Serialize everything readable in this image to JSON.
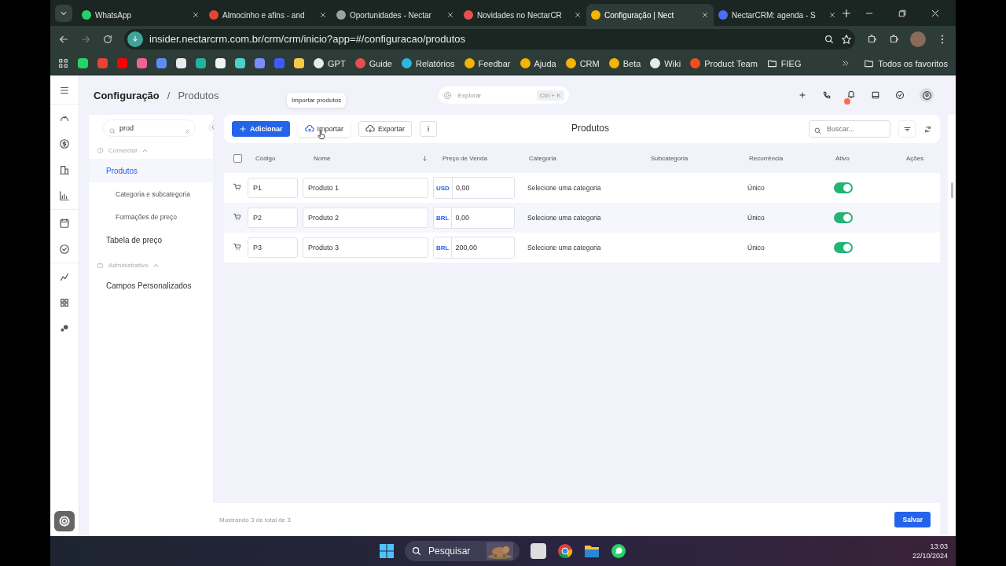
{
  "browser": {
    "tabs": [
      {
        "title": "WhatsApp",
        "color": "#25d366",
        "selected": false
      },
      {
        "title": "Almocinho e afins - and",
        "color": "#ea4335",
        "selected": false
      },
      {
        "title": "Oportunidades - Nectar",
        "color": "#9aa0a6",
        "selected": false
      },
      {
        "title": "Novidades no NectarCR",
        "color": "#e84f4f",
        "selected": false
      },
      {
        "title": "Configuração | Nect",
        "color": "#f5b400",
        "selected": true
      },
      {
        "title": "NectarCRM: agenda - S",
        "color": "#4a6cf7",
        "selected": false
      }
    ],
    "url": "insider.nectarcrm.com.br/crm/crm/inicio?app=#/configuracao/produtos",
    "bookmarks": [
      {
        "kind": "icon",
        "color": "#25d366"
      },
      {
        "kind": "icon",
        "color": "#ea4335"
      },
      {
        "kind": "icon",
        "color": "#ff0000"
      },
      {
        "kind": "icon",
        "color": "#f06292"
      },
      {
        "kind": "icon",
        "color": "#5c8df6"
      },
      {
        "kind": "icon",
        "color": "#e8eaed"
      },
      {
        "kind": "icon",
        "color": "#1fb59a"
      },
      {
        "kind": "icon",
        "color": "#f1f3f4"
      },
      {
        "kind": "icon",
        "color": "#4dd0c8"
      },
      {
        "kind": "icon",
        "color": "#7b8cff"
      },
      {
        "kind": "icon",
        "color": "#3f5bff"
      },
      {
        "kind": "icon",
        "color": "#f7c948"
      },
      {
        "kind": "link",
        "label": "GPT",
        "color": "#e8eaed"
      },
      {
        "kind": "link",
        "label": "Guide",
        "color": "#e84f4f"
      },
      {
        "kind": "link",
        "label": "Relatórios",
        "color": "#2ab7e0"
      },
      {
        "kind": "link",
        "label": "Feedbar",
        "color": "#f5b400"
      },
      {
        "kind": "link",
        "label": "Ajuda",
        "color": "#f5b400"
      },
      {
        "kind": "link",
        "label": "CRM",
        "color": "#f5b400"
      },
      {
        "kind": "link",
        "label": "Beta",
        "color": "#f5b400"
      },
      {
        "kind": "link",
        "label": "Wiki",
        "color": "#e8eaed"
      },
      {
        "kind": "link",
        "label": "Product Team",
        "color": "#f24e1e"
      },
      {
        "kind": "folder",
        "label": "FIEG"
      }
    ],
    "all_bookmarks": "Todos os favoritos"
  },
  "app": {
    "breadcrumb": [
      "Configuração",
      "Produtos"
    ],
    "breadcrumb_separator": "/",
    "explore": {
      "placeholder": "Explorar",
      "shortcut": "Ctrl + K"
    },
    "sidebar": {
      "search": "prod",
      "groups": [
        {
          "label": "Comercial",
          "expanded": true,
          "children": [
            {
              "label": "Produtos",
              "selected": true,
              "children": [
                {
                  "label": "Categoria e subcategoria",
                  "selected": false
                },
                {
                  "label": "Formações de preço",
                  "selected": false
                }
              ]
            },
            {
              "label": "Tabela de preço",
              "selected": false
            }
          ]
        },
        {
          "label": "Administrativo",
          "expanded": true,
          "children": [
            {
              "label": "Campos Personalizados",
              "selected": false
            }
          ]
        }
      ]
    },
    "toolbar": {
      "buttons": [
        {
          "kind": "primary",
          "label": "Adicionar"
        },
        {
          "kind": "import",
          "label": "Importar"
        },
        {
          "kind": "export",
          "label": "Exportar"
        }
      ],
      "tooltip": "Importar produtos",
      "title": "Produtos",
      "search_placeholder": "Buscar..."
    },
    "table": {
      "select_all": {
        "checked": false
      },
      "columns": [
        "Código",
        "Nome",
        "Preço de Venda",
        "Categoria",
        "Subcategoria",
        "Recorrência",
        "Ativo",
        "Ações"
      ],
      "rows": [
        {
          "code": "P1",
          "name": "Produto 1",
          "currency": "USD",
          "price": "0,00",
          "category": "Selecione uma categoria",
          "recurrence": "Único",
          "active": true
        },
        {
          "code": "P2",
          "name": "Produto 2",
          "currency": "BRL",
          "price": "0,00",
          "category": "Selecione uma categoria",
          "recurrence": "Único",
          "active": true
        },
        {
          "code": "P3",
          "name": "Produto 3",
          "currency": "BRL",
          "price": "200,00",
          "category": "Selecione uma categoria",
          "recurrence": "Único",
          "active": true
        }
      ]
    },
    "footer": {
      "summary": "Mostrando 3 de total de 3",
      "save": "Salvar"
    }
  },
  "taskbar": {
    "search": "Pesquisar",
    "time": "13:03",
    "date": "22/10/2024"
  }
}
